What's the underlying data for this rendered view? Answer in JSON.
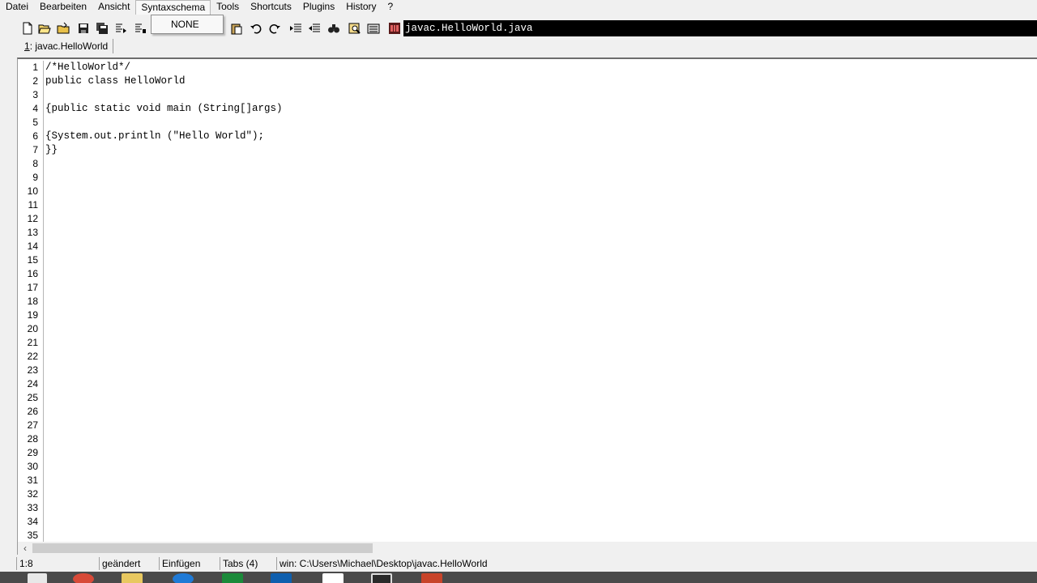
{
  "menubar": {
    "items": [
      "Datei",
      "Bearbeiten",
      "Ansicht",
      "Syntaxschema",
      "Tools",
      "Shortcuts",
      "Plugins",
      "History",
      "?"
    ]
  },
  "syntax_dropdown": {
    "items": [
      "NONE"
    ]
  },
  "toolbar": {
    "buttons": [
      "new-file-icon",
      "open-file-icon",
      "open-folder-icon",
      "save-icon",
      "save-all-icon",
      "compile-icon",
      "run-icon",
      "paste-icon",
      "undo-icon",
      "redo-icon",
      "indent-icon",
      "outdent-icon",
      "find-icon",
      "zoom-icon",
      "print-icon",
      "cmd-icon"
    ],
    "title_field": "javac.HelloWorld.java"
  },
  "tabs": [
    {
      "index": "1",
      "label": "javac.HelloWorld"
    }
  ],
  "editor": {
    "line_numbers": [
      "1",
      "2",
      "3",
      "4",
      "5",
      "6",
      "7",
      "8",
      "9",
      "10",
      "11",
      "12",
      "13",
      "14",
      "15",
      "16",
      "17",
      "18",
      "19",
      "20",
      "21",
      "22",
      "23",
      "24",
      "25",
      "26",
      "27",
      "28",
      "29",
      "30",
      "31",
      "32",
      "33",
      "34",
      "35"
    ],
    "code_lines": [
      "/*HelloWorld*/",
      "public class HelloWorld",
      "",
      "{public static void main (String[]args)",
      "",
      "{System.out.println (\"Hello World\");",
      "}}"
    ]
  },
  "statusbar": {
    "position": "1:8",
    "modified": "geändert",
    "mode": "Einfügen",
    "tabs": "Tabs (4)",
    "path": "win: C:\\Users\\Michael\\Desktop\\javac.HelloWorld"
  },
  "colors": {
    "title_field_bg": "#000000",
    "editor_bg": "#ffffff",
    "chrome_bg": "#f0f0f0",
    "taskbar_bg": "#4a4a4a"
  }
}
